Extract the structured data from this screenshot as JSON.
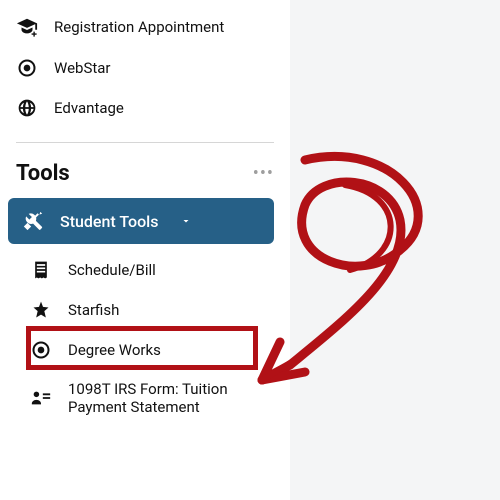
{
  "quicklinks": {
    "items": [
      {
        "label": "Registration Appointment",
        "icon": "grad-cap-plus-icon"
      },
      {
        "label": "WebStar",
        "icon": "target-icon"
      },
      {
        "label": "Edvantage",
        "icon": "globe-icon"
      }
    ]
  },
  "tools": {
    "heading": "Tools",
    "dropdown_label": "Student Tools",
    "items": [
      {
        "label": "Schedule/Bill",
        "icon": "receipt-icon"
      },
      {
        "label": "Starfish",
        "icon": "star-icon"
      },
      {
        "label": "Degree Works",
        "icon": "target-icon",
        "highlighted": true
      },
      {
        "label": "1098T IRS Form: Tuition Payment Statement",
        "icon": "person-card-icon"
      }
    ]
  },
  "accent_color": "#266087",
  "highlight_color": "#b11116"
}
